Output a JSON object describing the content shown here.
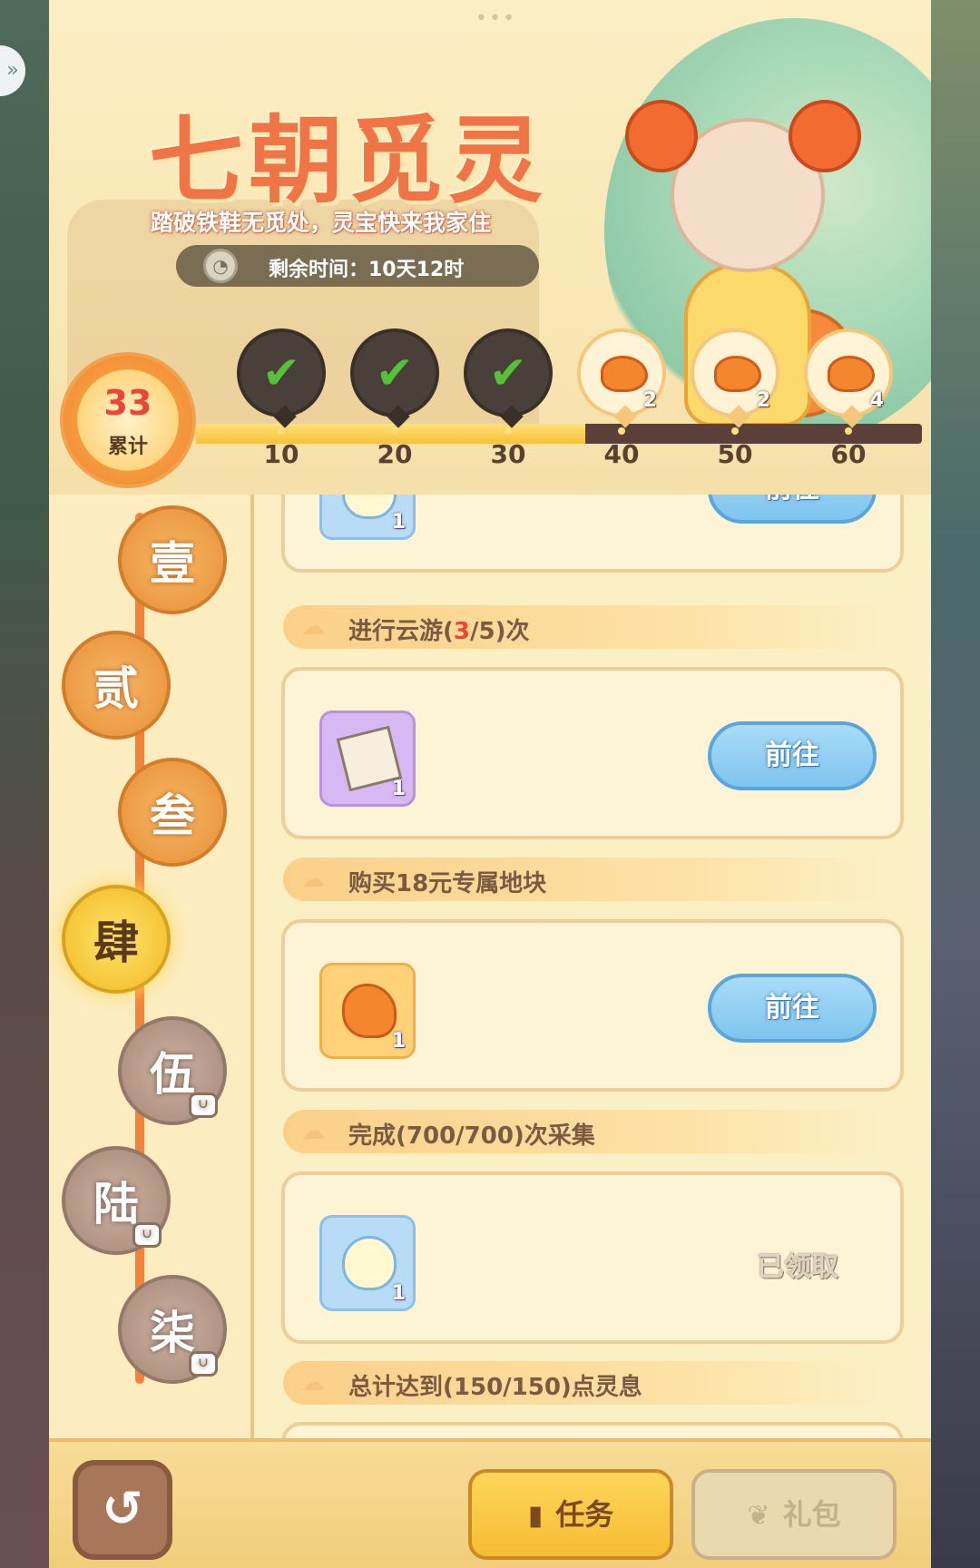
{
  "event": {
    "title": "七朝觅灵",
    "subtitle": "踏破铁鞋无觅处，灵宝快来我家住",
    "timer_label": "剩余时间：10天12时"
  },
  "progress": {
    "count": "33",
    "count_label": "累计",
    "current_value": 33,
    "max_value": 60,
    "milestones": [
      {
        "tick": "10",
        "status": "claimed",
        "qty": ""
      },
      {
        "tick": "20",
        "status": "claimed",
        "qty": ""
      },
      {
        "tick": "30",
        "status": "claimed",
        "qty": ""
      },
      {
        "tick": "40",
        "status": "locked",
        "qty": "2"
      },
      {
        "tick": "50",
        "status": "locked",
        "qty": "2"
      },
      {
        "tick": "60",
        "status": "locked",
        "qty": "4"
      }
    ]
  },
  "chapters": [
    {
      "label": "壹",
      "state": "open"
    },
    {
      "label": "贰",
      "state": "open"
    },
    {
      "label": "叁",
      "state": "open"
    },
    {
      "label": "肆",
      "state": "active"
    },
    {
      "label": "伍",
      "state": "locked"
    },
    {
      "label": "陆",
      "state": "locked"
    },
    {
      "label": "柒",
      "state": "locked"
    }
  ],
  "tasks": {
    "partial_top": {
      "qty": "1",
      "button": "前往"
    },
    "items": [
      {
        "header_pre": "进行云游(",
        "header_hl": "3",
        "header_post": "/5)次",
        "qty": "1",
        "button": "前往"
      },
      {
        "header_pre": "购买18元专属地块",
        "header_hl": "",
        "header_post": "",
        "qty": "1",
        "button": "前往"
      },
      {
        "header_pre": "完成(700/700)次采集",
        "header_hl": "",
        "header_post": "",
        "qty": "1",
        "button": "已领取"
      },
      {
        "header_pre": "总计达到(150/150)点灵息",
        "header_hl": "",
        "header_post": ""
      }
    ]
  },
  "bottom": {
    "tab_tasks": "任务",
    "tab_gifts": "礼包"
  },
  "icons": {
    "back": "return-arrow-icon",
    "tasks": "book-icon",
    "gifts": "gift-bag-icon",
    "timer": "clock-icon",
    "task_header": "cloud-icon"
  },
  "colors": {
    "accent_orange": "#ef7546",
    "progress_fill": "#f6c23a",
    "button_blue": "#7fc4ef",
    "highlight_red": "#e84637"
  }
}
